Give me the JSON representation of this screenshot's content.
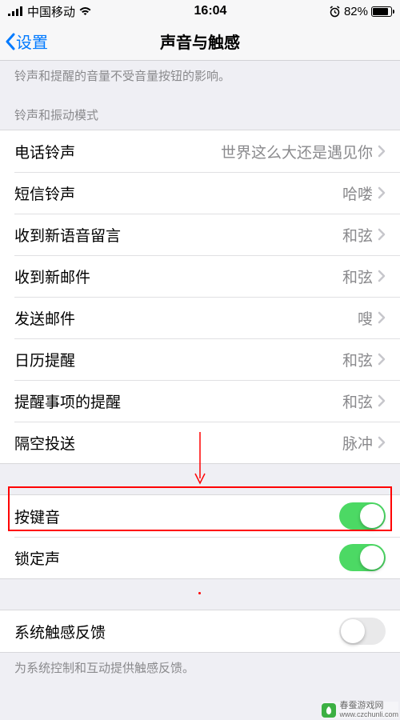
{
  "status": {
    "carrier": "中国移动",
    "time": "16:04",
    "battery": "82%"
  },
  "nav": {
    "back": "设置",
    "title": "声音与触感"
  },
  "footer1": "铃声和提醒的音量不受音量按钮的影响。",
  "section1": "铃声和振动模式",
  "rows": [
    {
      "label": "电话铃声",
      "value": "世界这么大还是遇见你"
    },
    {
      "label": "短信铃声",
      "value": "哈喽"
    },
    {
      "label": "收到新语音留言",
      "value": "和弦"
    },
    {
      "label": "收到新邮件",
      "value": "和弦"
    },
    {
      "label": "发送邮件",
      "value": "嗖"
    },
    {
      "label": "日历提醒",
      "value": "和弦"
    },
    {
      "label": "提醒事项的提醒",
      "value": "和弦"
    },
    {
      "label": "隔空投送",
      "value": "脉冲"
    }
  ],
  "toggles": {
    "keyclick": "按键音",
    "lock": "锁定声"
  },
  "toggles2": {
    "haptic": "系统触感反馈"
  },
  "footer2": "为系统控制和互动提供触感反馈。",
  "watermark": {
    "line1": "春蚕游戏网",
    "line2": "www.czchunli.com"
  }
}
